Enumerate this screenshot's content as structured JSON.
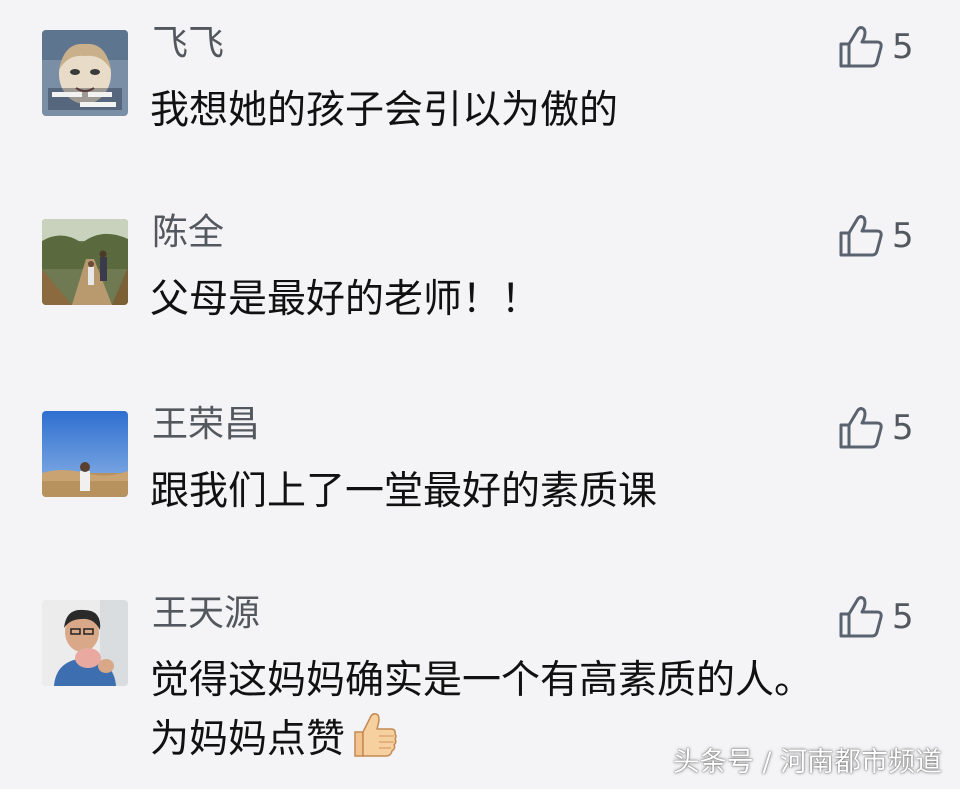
{
  "colors": {
    "background": "#f4f4f6",
    "name_text": "#53575e",
    "comment_text": "#111111",
    "like_icon": "#5a6270"
  },
  "comments": [
    {
      "avatar_icon": "avatar-cartoon-portrait",
      "name": "飞飞",
      "text": "我想她的孩子会引以为傲的",
      "likes": "5"
    },
    {
      "avatar_icon": "avatar-forest-path-photo",
      "name": "陈全",
      "text": "父母是最好的老师！！",
      "likes": "5"
    },
    {
      "avatar_icon": "avatar-blue-sky-field-photo",
      "name": "王荣昌",
      "text": "跟我们上了一堂最好的素质课",
      "likes": "5"
    },
    {
      "avatar_icon": "avatar-man-photo",
      "name": "王天源",
      "text_line1": "觉得这妈妈确实是一个有高素质的人。",
      "text_line2": "为妈妈点赞",
      "emoji_icon": "thumbs-up-emoji",
      "likes": "5"
    }
  ],
  "watermark": "头条号 / 河南都市频道"
}
